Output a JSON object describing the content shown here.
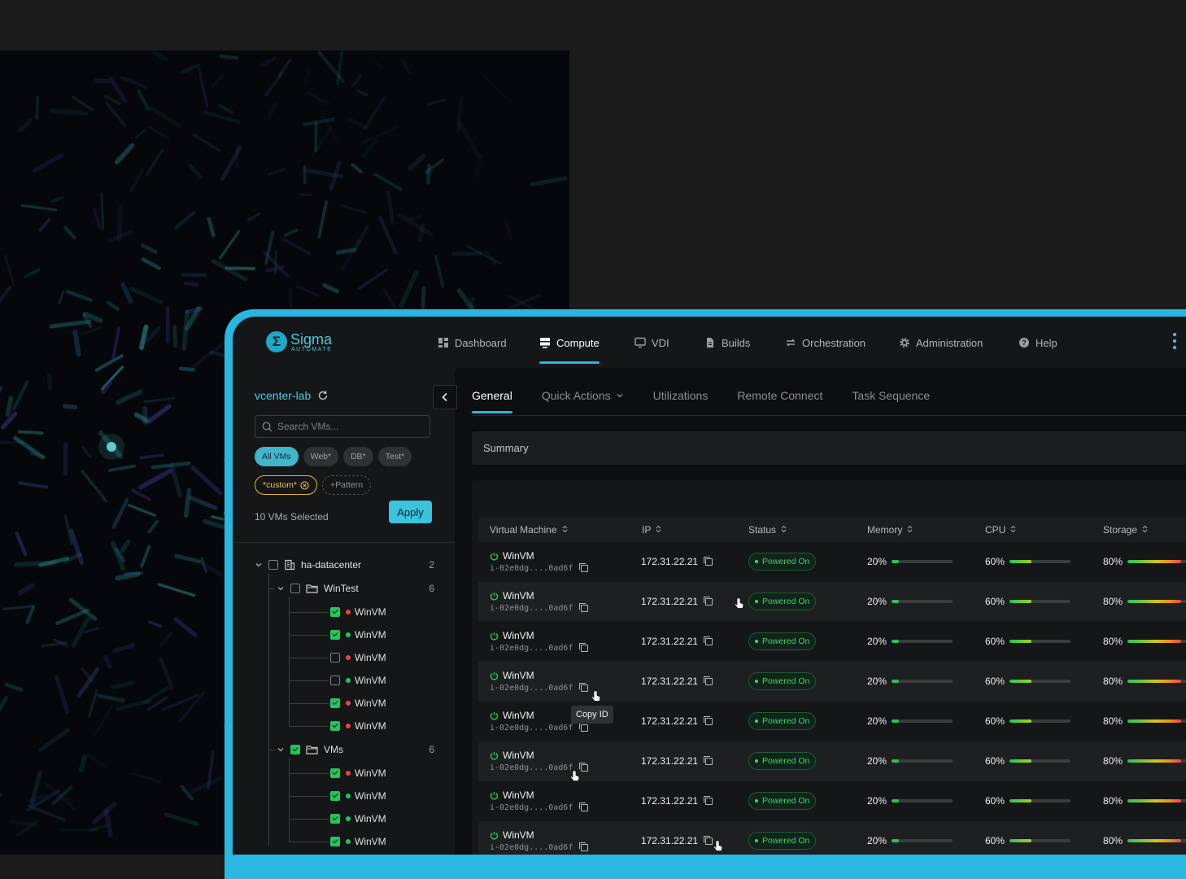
{
  "brand": {
    "name": "Sigma",
    "subtitle": "AUTOMATE",
    "accent": "#29b6e0"
  },
  "nav": [
    {
      "label": "Dashboard",
      "icon": "dashboard-icon"
    },
    {
      "label": "Compute",
      "icon": "server-icon",
      "active": true
    },
    {
      "label": "VDI",
      "icon": "monitor-icon"
    },
    {
      "label": "Builds",
      "icon": "document-icon"
    },
    {
      "label": "Orchestration",
      "icon": "sync-arrows-icon"
    },
    {
      "label": "Administration",
      "icon": "gear-icon"
    },
    {
      "label": "Help",
      "icon": "help-icon"
    }
  ],
  "sidebar": {
    "datacenter_label": "vcenter-lab",
    "search_placeholder": "Search VMs...",
    "filter_chips": [
      "All VMs",
      "Web*",
      "DB*",
      "Test*"
    ],
    "custom_chip": "*custom*",
    "pattern_chip": "+Pattern",
    "selected_text": "10 VMs Selected",
    "apply_label": "Apply",
    "tree": {
      "root": {
        "label": "ha-datacenter",
        "count": "2"
      },
      "folders": [
        {
          "label": "WinTest",
          "count": "6",
          "checked": false,
          "vms": [
            {
              "label": "WinVM",
              "checked": true,
              "status": "red"
            },
            {
              "label": "WinVM",
              "checked": true,
              "status": "green"
            },
            {
              "label": "WinVM",
              "checked": false,
              "status": "red"
            },
            {
              "label": "WinVM",
              "checked": false,
              "status": "green"
            },
            {
              "label": "WinVM",
              "checked": true,
              "status": "red"
            },
            {
              "label": "WinVM",
              "checked": true,
              "status": "red"
            }
          ]
        },
        {
          "label": "VMs",
          "count": "6",
          "checked": true,
          "vms": [
            {
              "label": "WinVM",
              "checked": true,
              "status": "red"
            },
            {
              "label": "WinVM",
              "checked": true,
              "status": "green"
            },
            {
              "label": "WinVM",
              "checked": true,
              "status": "green"
            },
            {
              "label": "WinVM",
              "checked": true,
              "status": "green"
            }
          ]
        }
      ]
    }
  },
  "tabs": [
    {
      "label": "General",
      "active": true
    },
    {
      "label": "Quick Actions",
      "dropdown": true
    },
    {
      "label": "Utilizations"
    },
    {
      "label": "Remote Connect"
    },
    {
      "label": "Task Sequence"
    }
  ],
  "summary_label": "Summary",
  "table": {
    "columns": [
      "Virtual Machine",
      "IP",
      "Status",
      "Memory",
      "CPU",
      "Storage"
    ],
    "rows": [
      {
        "name": "WinVM",
        "id": "i-02e0dg....0ad6f",
        "ip": "172.31.22.21",
        "status": "Powered On",
        "memory": "20%",
        "cpu": "60%",
        "storage": "80%",
        "mem_level": 0.2,
        "cpu_level": 0.6,
        "storage_level": 0.8
      },
      {
        "name": "WinVM",
        "id": "i-02e0dg....0ad6f",
        "ip": "172.31.22.21",
        "status": "Powered On",
        "memory": "20%",
        "cpu": "60%",
        "storage": "80%",
        "mem_level": 0.2,
        "cpu_level": 0.6,
        "storage_level": 0.8
      },
      {
        "name": "WinVM",
        "id": "i-02e0dg....0ad6f",
        "ip": "172.31.22.21",
        "status": "Powered On",
        "memory": "20%",
        "cpu": "60%",
        "storage": "80%",
        "mem_level": 0.2,
        "cpu_level": 0.6,
        "storage_level": 0.8
      },
      {
        "name": "WinVM",
        "id": "i-02e0dg....0ad6f",
        "ip": "172.31.22.21",
        "status": "Powered On",
        "memory": "20%",
        "cpu": "60%",
        "storage": "80%",
        "mem_level": 0.2,
        "cpu_level": 0.6,
        "storage_level": 0.8
      },
      {
        "name": "WinVM",
        "id": "i-02e0dg....0ad6f",
        "ip": "172.31.22.21",
        "status": "Powered On",
        "memory": "20%",
        "cpu": "60%",
        "storage": "80%",
        "mem_level": 0.2,
        "cpu_level": 0.6,
        "storage_level": 0.8
      },
      {
        "name": "WinVM",
        "id": "i-02e0dg....0ad6f",
        "ip": "172.31.22.21",
        "status": "Powered On",
        "memory": "20%",
        "cpu": "60%",
        "storage": "80%",
        "mem_level": 0.2,
        "cpu_level": 0.6,
        "storage_level": 0.8
      },
      {
        "name": "WinVM",
        "id": "i-02e0dg....0ad6f",
        "ip": "172.31.22.21",
        "status": "Powered On",
        "memory": "20%",
        "cpu": "60%",
        "storage": "80%",
        "mem_level": 0.2,
        "cpu_level": 0.6,
        "storage_level": 0.8
      },
      {
        "name": "WinVM",
        "id": "i-02e0dg....0ad6f",
        "ip": "172.31.22.21",
        "status": "Powered On",
        "memory": "20%",
        "cpu": "60%",
        "storage": "80%",
        "mem_level": 0.2,
        "cpu_level": 0.6,
        "storage_level": 0.8
      }
    ]
  },
  "tooltip": "Copy ID",
  "colors": {
    "powered_on": "#3fd26f",
    "status_red": "#ef4444",
    "status_green": "#22c55e",
    "memory_bar": "#22c55e",
    "cpu_bar": "#84cc16"
  }
}
